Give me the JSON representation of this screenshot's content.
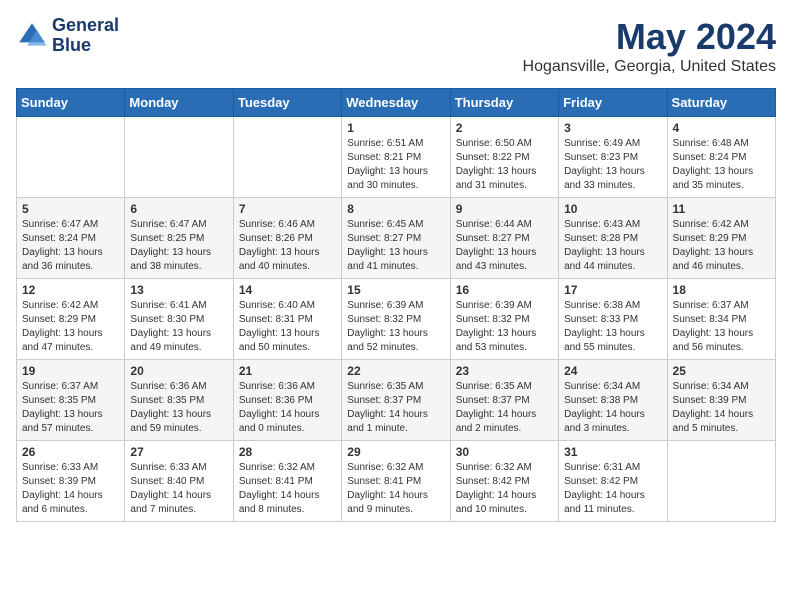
{
  "header": {
    "logo_line1": "General",
    "logo_line2": "Blue",
    "month_title": "May 2024",
    "location": "Hogansville, Georgia, United States"
  },
  "weekdays": [
    "Sunday",
    "Monday",
    "Tuesday",
    "Wednesday",
    "Thursday",
    "Friday",
    "Saturday"
  ],
  "weeks": [
    [
      {
        "day": "",
        "info": ""
      },
      {
        "day": "",
        "info": ""
      },
      {
        "day": "",
        "info": ""
      },
      {
        "day": "1",
        "info": "Sunrise: 6:51 AM\nSunset: 8:21 PM\nDaylight: 13 hours and 30 minutes."
      },
      {
        "day": "2",
        "info": "Sunrise: 6:50 AM\nSunset: 8:22 PM\nDaylight: 13 hours and 31 minutes."
      },
      {
        "day": "3",
        "info": "Sunrise: 6:49 AM\nSunset: 8:23 PM\nDaylight: 13 hours and 33 minutes."
      },
      {
        "day": "4",
        "info": "Sunrise: 6:48 AM\nSunset: 8:24 PM\nDaylight: 13 hours and 35 minutes."
      }
    ],
    [
      {
        "day": "5",
        "info": "Sunrise: 6:47 AM\nSunset: 8:24 PM\nDaylight: 13 hours and 36 minutes."
      },
      {
        "day": "6",
        "info": "Sunrise: 6:47 AM\nSunset: 8:25 PM\nDaylight: 13 hours and 38 minutes."
      },
      {
        "day": "7",
        "info": "Sunrise: 6:46 AM\nSunset: 8:26 PM\nDaylight: 13 hours and 40 minutes."
      },
      {
        "day": "8",
        "info": "Sunrise: 6:45 AM\nSunset: 8:27 PM\nDaylight: 13 hours and 41 minutes."
      },
      {
        "day": "9",
        "info": "Sunrise: 6:44 AM\nSunset: 8:27 PM\nDaylight: 13 hours and 43 minutes."
      },
      {
        "day": "10",
        "info": "Sunrise: 6:43 AM\nSunset: 8:28 PM\nDaylight: 13 hours and 44 minutes."
      },
      {
        "day": "11",
        "info": "Sunrise: 6:42 AM\nSunset: 8:29 PM\nDaylight: 13 hours and 46 minutes."
      }
    ],
    [
      {
        "day": "12",
        "info": "Sunrise: 6:42 AM\nSunset: 8:29 PM\nDaylight: 13 hours and 47 minutes."
      },
      {
        "day": "13",
        "info": "Sunrise: 6:41 AM\nSunset: 8:30 PM\nDaylight: 13 hours and 49 minutes."
      },
      {
        "day": "14",
        "info": "Sunrise: 6:40 AM\nSunset: 8:31 PM\nDaylight: 13 hours and 50 minutes."
      },
      {
        "day": "15",
        "info": "Sunrise: 6:39 AM\nSunset: 8:32 PM\nDaylight: 13 hours and 52 minutes."
      },
      {
        "day": "16",
        "info": "Sunrise: 6:39 AM\nSunset: 8:32 PM\nDaylight: 13 hours and 53 minutes."
      },
      {
        "day": "17",
        "info": "Sunrise: 6:38 AM\nSunset: 8:33 PM\nDaylight: 13 hours and 55 minutes."
      },
      {
        "day": "18",
        "info": "Sunrise: 6:37 AM\nSunset: 8:34 PM\nDaylight: 13 hours and 56 minutes."
      }
    ],
    [
      {
        "day": "19",
        "info": "Sunrise: 6:37 AM\nSunset: 8:35 PM\nDaylight: 13 hours and 57 minutes."
      },
      {
        "day": "20",
        "info": "Sunrise: 6:36 AM\nSunset: 8:35 PM\nDaylight: 13 hours and 59 minutes."
      },
      {
        "day": "21",
        "info": "Sunrise: 6:36 AM\nSunset: 8:36 PM\nDaylight: 14 hours and 0 minutes."
      },
      {
        "day": "22",
        "info": "Sunrise: 6:35 AM\nSunset: 8:37 PM\nDaylight: 14 hours and 1 minute."
      },
      {
        "day": "23",
        "info": "Sunrise: 6:35 AM\nSunset: 8:37 PM\nDaylight: 14 hours and 2 minutes."
      },
      {
        "day": "24",
        "info": "Sunrise: 6:34 AM\nSunset: 8:38 PM\nDaylight: 14 hours and 3 minutes."
      },
      {
        "day": "25",
        "info": "Sunrise: 6:34 AM\nSunset: 8:39 PM\nDaylight: 14 hours and 5 minutes."
      }
    ],
    [
      {
        "day": "26",
        "info": "Sunrise: 6:33 AM\nSunset: 8:39 PM\nDaylight: 14 hours and 6 minutes."
      },
      {
        "day": "27",
        "info": "Sunrise: 6:33 AM\nSunset: 8:40 PM\nDaylight: 14 hours and 7 minutes."
      },
      {
        "day": "28",
        "info": "Sunrise: 6:32 AM\nSunset: 8:41 PM\nDaylight: 14 hours and 8 minutes."
      },
      {
        "day": "29",
        "info": "Sunrise: 6:32 AM\nSunset: 8:41 PM\nDaylight: 14 hours and 9 minutes."
      },
      {
        "day": "30",
        "info": "Sunrise: 6:32 AM\nSunset: 8:42 PM\nDaylight: 14 hours and 10 minutes."
      },
      {
        "day": "31",
        "info": "Sunrise: 6:31 AM\nSunset: 8:42 PM\nDaylight: 14 hours and 11 minutes."
      },
      {
        "day": "",
        "info": ""
      }
    ]
  ]
}
